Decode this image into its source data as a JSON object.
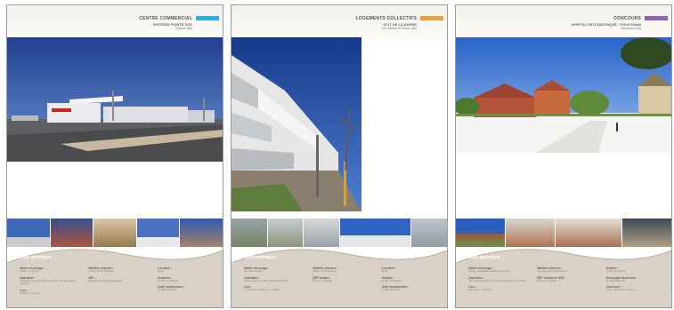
{
  "panels": [
    {
      "category": "CENTRE COMMERCIAL",
      "title": "POITIERS POINTE SUD",
      "location": "Poitiers (86)",
      "accent": "#2bb0e6",
      "fiche_title": "Fiche technique",
      "col1": [
        {
          "k": "Maître d'ouvrage :",
          "v": "SARL Le Grand"
        },
        {
          "k": "Opération :",
          "v": "Construction d'un hypermarché et de boutiques annexes"
        },
        {
          "k": "Lieu :",
          "v": "Poitiers - Vienne"
        }
      ],
      "col2": [
        {
          "k": "Maîtrise d'œuvre :",
          "v": "Cabinet d'architecture"
        },
        {
          "k": "BET :",
          "v": "Ingénierie & Développement"
        }
      ],
      "col3": [
        {
          "k": "Livraison :",
          "v": "2010"
        },
        {
          "k": "Surfaces :",
          "v": "12 000 m² SHON"
        },
        {
          "k": "Coût construction :",
          "v": "14 000 000 € HT"
        }
      ]
    },
    {
      "category": "LOGEMENTS COLLECTIFS",
      "title": "ILOT DE LA BARRE",
      "location": "Les Sables d'Olonne (85)",
      "accent": "#e8a23a",
      "fiche_title": "Fiche technique",
      "col1": [
        {
          "k": "Maître d'ouvrage :",
          "v": "Vendée Habitat"
        },
        {
          "k": "Opération :",
          "v": "Construction de 48 logements PLUS"
        },
        {
          "k": "Lieu :",
          "v": "Les Sables d'Olonne - Vendée"
        }
      ],
      "col2": [
        {
          "k": "Maîtrise d'œuvre :",
          "v": "Atelier d'architecture"
        },
        {
          "k": "BET fluides :",
          "v": "Bureau d'études"
        }
      ],
      "col3": [
        {
          "k": "Livraison :",
          "v": "2009"
        },
        {
          "k": "Surface :",
          "v": "3 600 m² SHON"
        },
        {
          "k": "Coût construction :",
          "v": "5 200 000 € HT"
        }
      ]
    },
    {
      "category": "CONCOURS",
      "title": "HOPITAL PSYCHIATRIQUE - PÔLE EHAM",
      "location": "Bordeaux (33)",
      "accent": "#8e63b5",
      "fiche_title": "Fiche technique",
      "col1": [
        {
          "k": "Maître d'ouvrage :",
          "v": "Centre Hospitalier Charles Perrens"
        },
        {
          "k": "Opération :",
          "v": "Construction d'une unité d'admission et de soins"
        },
        {
          "k": "Lieu :",
          "v": "Bordeaux - Gironde"
        }
      ],
      "col2": [
        {
          "k": "Maîtrise d'œuvre :",
          "v": "Groupement d'architectes"
        },
        {
          "k": "BET fluides et VRD :",
          "v": "Bureau d'études"
        }
      ],
      "col3": [
        {
          "k": "Surface :",
          "v": "7 200 m² SHON"
        },
        {
          "k": "Enveloppe financière :",
          "v": "11 500 000 € HT"
        },
        {
          "k": "Concours :",
          "v": "2008 - Projet non retenu"
        }
      ]
    }
  ]
}
